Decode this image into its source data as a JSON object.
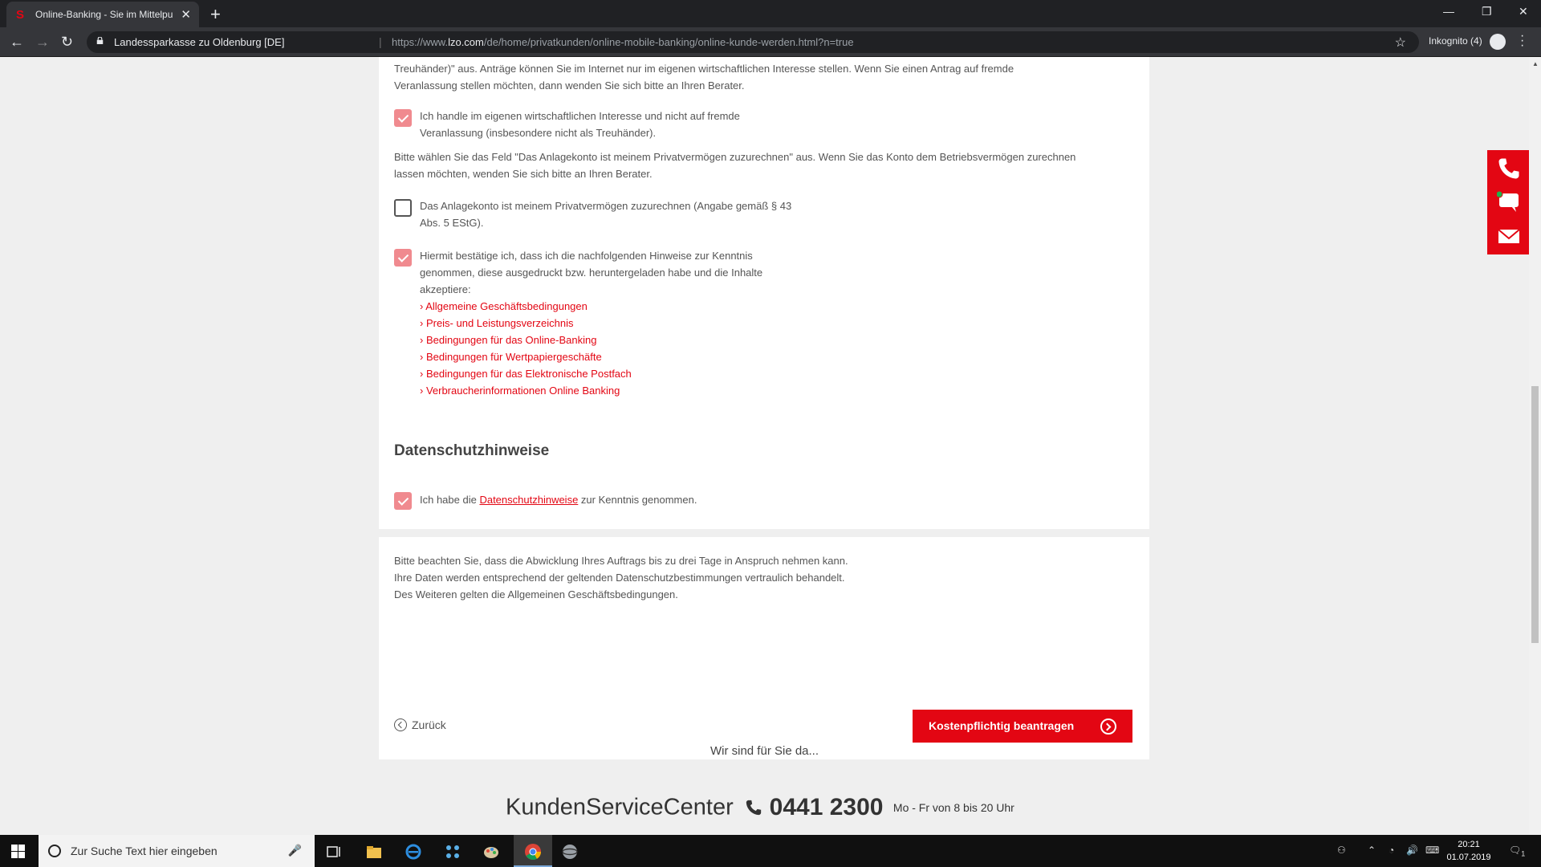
{
  "browser": {
    "tab_title": "Online-Banking - Sie im Mittelpu",
    "tab_favicon": "S",
    "new_tab": "+",
    "site_identity": "Landessparkasse zu Oldenburg [DE]",
    "url_prefix": "https://www.",
    "url_domain": "lzo.com",
    "url_path": "/de/home/privatkunden/online-mobile-banking/online-kunde-werden.html?n=true",
    "incognito_label": "Inkognito (4)",
    "icons": [
      "back-arrow-icon",
      "forward-arrow-icon",
      "reload-icon",
      "lock-icon",
      "star-icon",
      "incognito-icon",
      "menu-icon"
    ]
  },
  "form": {
    "intro_text_line1": "Treuhänder)\" aus. Anträge können Sie im Internet nur im eigenen wirtschaftlichen Interesse stellen. Wenn Sie einen Antrag auf fremde",
    "intro_text_line2": "Veranlassung stellen möchten, dann wenden Sie sich bitte an Ihren Berater.",
    "checkbox_own_interest": {
      "checked": true,
      "label_line1": "Ich handle im eigenen wirtschaftlichen Interesse und nicht auf fremde",
      "label_line2": "Veranlassung (insbesondere nicht als Treuhänder)."
    },
    "private_assets_text_line1": "Bitte wählen Sie das Feld \"Das Anlagekonto ist meinem Privatvermögen zuzurechnen\" aus. Wenn Sie das Konto dem Betriebsvermögen zurechnen",
    "private_assets_text_line2": "lassen möchten, wenden Sie sich bitte an Ihren Berater.",
    "checkbox_private_assets": {
      "checked": false,
      "label_line1": "Das Anlagekonto ist meinem Privatvermögen zuzurechnen (Angabe gemäß § 43",
      "label_line2": "Abs. 5 EStG)."
    },
    "checkbox_terms": {
      "checked": true,
      "label_line1": "Hiermit bestätige ich, dass ich die nachfolgenden Hinweise zur Kenntnis",
      "label_line2": "genommen, diese ausgedruckt bzw. heruntergeladen habe und die Inhalte",
      "label_line3": "akzeptiere:"
    },
    "documents": [
      "› Allgemeine Geschäftsbedingungen",
      "› Preis- und Leistungsverzeichnis",
      "› Bedingungen für das Online-Banking",
      "› Bedingungen für Wertpapiergeschäfte",
      "› Bedingungen für das Elektronische Postfach",
      "› Verbraucherinformationen Online Banking"
    ]
  },
  "privacy": {
    "title": "Datenschutzhinweise",
    "checked": true,
    "label_before": "Ich habe die ",
    "label_link": "Datenschutzhinweise",
    "label_after": " zur Kenntnis genommen."
  },
  "notice": {
    "line1": "Bitte beachten Sie, dass die Abwicklung Ihres Auftrags bis zu drei Tage in Anspruch nehmen kann.",
    "line2": "Ihre Daten werden entsprechend der geltenden Datenschutzbestimmungen vertraulich behandelt.",
    "line3": "Des Weiteren gelten die Allgemeinen Geschäftsbedingungen.",
    "back_label": "Zurück",
    "submit_label": "Kostenpflichtig beantragen"
  },
  "footer": {
    "lead": "Wir sind für Sie da...",
    "service_name": "KundenServiceCenter",
    "phone": "0441 2300",
    "hours": "Mo - Fr von 8 bis 20 Uhr"
  },
  "side_widget": {
    "icons": [
      "phone-icon",
      "chat-icon",
      "mail-icon"
    ]
  },
  "taskbar": {
    "search_placeholder": "Zur Suche Text hier eingeben",
    "time": "20:21",
    "date": "01.07.2019",
    "notification_count": "1"
  },
  "colors": {
    "brand_red": "#e30613",
    "checkbox_checked": "#f08a8f",
    "page_background": "#efefef"
  }
}
